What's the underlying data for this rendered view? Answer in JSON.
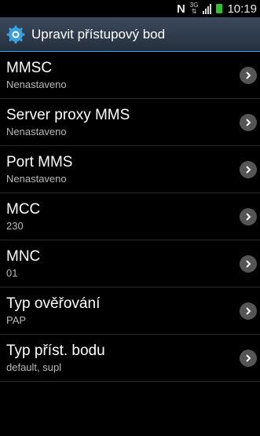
{
  "status_bar": {
    "network_type": "3G",
    "time": "10:19",
    "icons": [
      "nfc-icon",
      "network-3g-icon",
      "signal-icon",
      "battery-icon"
    ],
    "battery_color": "#2fc42f"
  },
  "header": {
    "title": "Upravit přístupový bod",
    "icon": "gear-icon",
    "accent_color": "#3aa0e0"
  },
  "settings": [
    {
      "label": "MMSC",
      "value": "Nenastaveno"
    },
    {
      "label": "Server proxy MMS",
      "value": "Nenastaveno"
    },
    {
      "label": "Port MMS",
      "value": "Nenastaveno"
    },
    {
      "label": "MCC",
      "value": "230"
    },
    {
      "label": "MNC",
      "value": "01"
    },
    {
      "label": "Typ ověřování",
      "value": "PAP"
    },
    {
      "label": "Typ příst. bodu",
      "value": "default, supl"
    }
  ]
}
